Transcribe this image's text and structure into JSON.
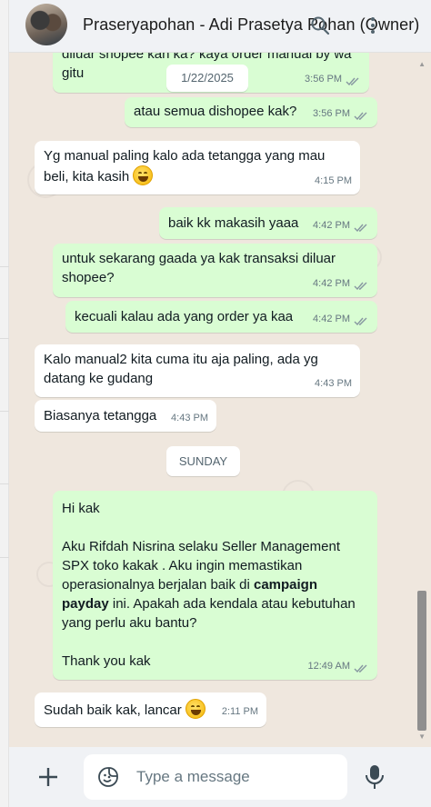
{
  "header": {
    "title": "Praseryapohan - Adi Prasetya Pohan (Owner)",
    "icons": [
      "avatar",
      "search-icon",
      "menu-icon"
    ]
  },
  "messages": [
    {
      "dir": "out",
      "text": "diluar shopee kan ka? kaya order manual by wa\ngitu",
      "time": "3:56 PM",
      "read": true
    },
    {
      "dir": "out",
      "text": "atau semua dishopee kak?",
      "time": "3:56 PM",
      "read": true
    },
    {
      "dir": "in",
      "text": "Yg manual paling kalo ada tetangga yang mau\nbeli, kita kasih",
      "emoji": "grinning-face",
      "time": "4:15 PM"
    },
    {
      "dir": "out",
      "text": "baik kk makasih yaaa",
      "time": "4:42 PM",
      "read": true
    },
    {
      "dir": "out",
      "text": "untuk sekarang gaada ya kak transaksi diluar\nshopee?",
      "time": "4:42 PM",
      "read": true
    },
    {
      "dir": "out",
      "text": "kecuali kalau ada yang order ya kaa",
      "time": "4:42 PM",
      "read": true
    },
    {
      "dir": "in",
      "text": "Kalo manual2 kita cuma itu aja paling, ada yg\ndatang ke gudang",
      "time": "4:43 PM"
    },
    {
      "dir": "in",
      "text": "Biasanya tetangga",
      "time": "4:43 PM"
    },
    {
      "dir": "out",
      "parts": {
        "greeting": "Hi kak",
        "line1": "Aku Rifdah Nisrina selaku Seller Management\nSPX toko kakak . Aku ingin memastikan\noperasionalnya berjalan baik di ",
        "bold1": "campaign\npayday",
        "line2": " ini. Apakah ada kendala atau kebutuhan\nyang perlu aku bantu?",
        "closing": "Thank you kak"
      },
      "time": "12:49 AM",
      "read": true
    },
    {
      "dir": "in",
      "text": "Sudah baik kak, lancar",
      "emoji": "grinning-face",
      "time": "2:11 PM"
    }
  ],
  "date_separators": [
    "1/22/2025",
    "SUNDAY"
  ],
  "composer": {
    "placeholder": "Type a message",
    "icons": [
      "plus-icon",
      "sticker-icon",
      "microphone-icon"
    ]
  },
  "colors": {
    "outgoing_bubble": "#d9fdd3",
    "incoming_bubble": "#ffffff",
    "chat_background": "#efe7de",
    "read_ticks": "#53bdeb"
  }
}
